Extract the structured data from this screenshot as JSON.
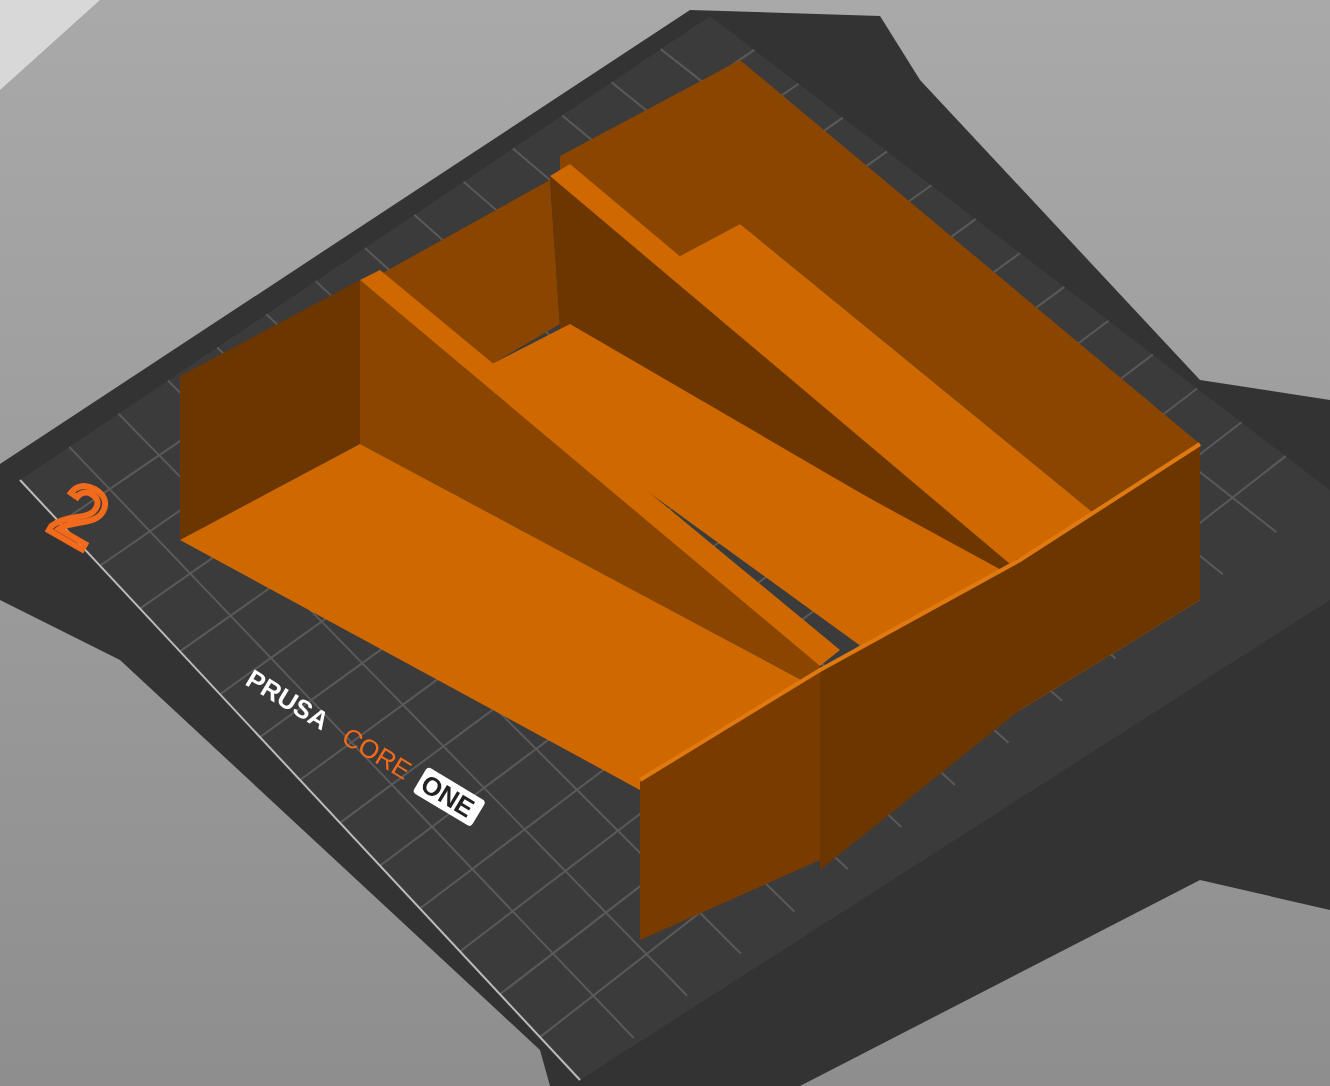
{
  "bed": {
    "number": "2",
    "logo": [
      {
        "text": "PRUSA",
        "kind": "plain"
      },
      {
        "text": "CORE",
        "kind": "accent"
      },
      {
        "text": "ONE",
        "kind": "boxed"
      }
    ]
  }
}
